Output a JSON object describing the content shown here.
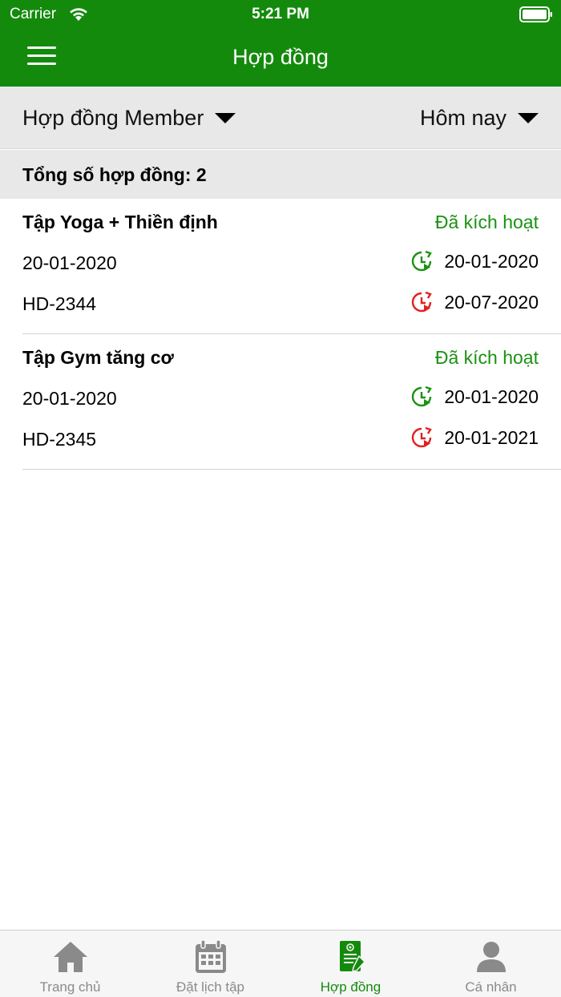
{
  "status_bar": {
    "carrier": "Carrier",
    "time": "5:21 PM"
  },
  "header": {
    "title": "Hợp đồng"
  },
  "filters": {
    "contract_type": "Hợp đồng Member",
    "date_range": "Hôm nay"
  },
  "summary": {
    "total_label": "Tổng số hợp đồng: 2"
  },
  "contracts": [
    {
      "name": "Tập Yoga + Thiền định",
      "status": "Đã kích hoạt",
      "created": "20-01-2020",
      "code": "HD-2344",
      "start": "20-01-2020",
      "end": "20-07-2020"
    },
    {
      "name": "Tập Gym tăng cơ",
      "status": "Đã kích hoạt",
      "created": "20-01-2020",
      "code": "HD-2345",
      "start": "20-01-2020",
      "end": "20-01-2021"
    }
  ],
  "tabs": [
    {
      "label": "Trang chủ",
      "icon": "home-icon"
    },
    {
      "label": "Đặt lịch tập",
      "icon": "calendar-icon"
    },
    {
      "label": "Hợp đồng",
      "icon": "contract-icon"
    },
    {
      "label": "Cá nhân",
      "icon": "person-icon"
    }
  ],
  "colors": {
    "primary": "#148a0d",
    "active_status": "#1a9212",
    "start_icon": "#1a9212",
    "end_icon": "#e02020",
    "inactive_tab": "#8a8a8a"
  }
}
